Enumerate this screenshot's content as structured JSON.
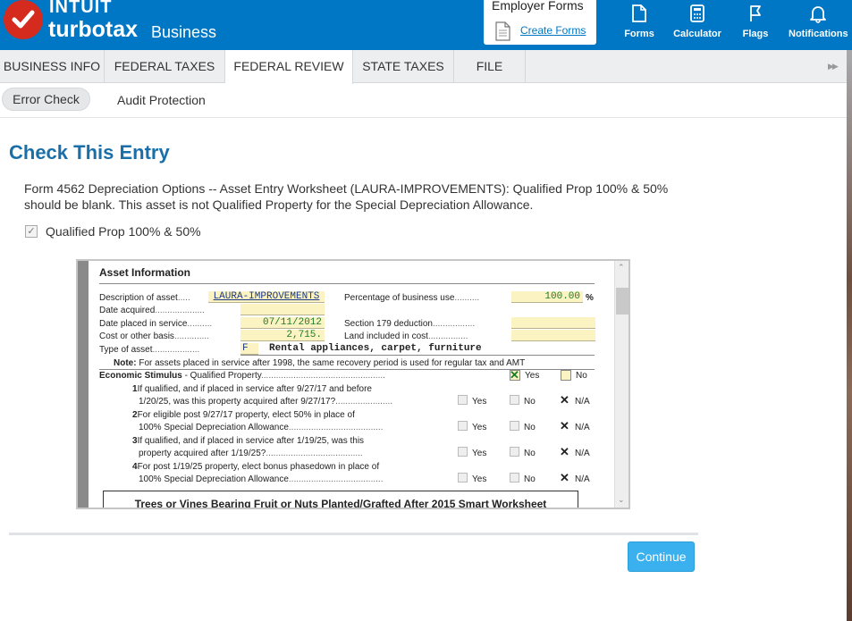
{
  "header": {
    "brand_top": "INTUIT",
    "brand_main": "turbotax",
    "brand_sub": "Business",
    "employer_title": "Employer Forms",
    "employer_link": "Create Forms",
    "buttons": [
      {
        "label": "Forms",
        "icon": "document-icon"
      },
      {
        "label": "Calculator",
        "icon": "calculator-icon"
      },
      {
        "label": "Flags",
        "icon": "flag-icon"
      },
      {
        "label": "Notifications",
        "icon": "bell-icon"
      }
    ]
  },
  "tabs": [
    "BUSINESS INFO",
    "FEDERAL TAXES",
    "FEDERAL REVIEW",
    "STATE TAXES",
    "FILE"
  ],
  "active_tab": "FEDERAL REVIEW",
  "subtabs": {
    "error_check": "Error Check",
    "audit_protection": "Audit Protection"
  },
  "page": {
    "title": "Check This Entry",
    "message": "Form 4562 Depreciation Options -- Asset Entry Worksheet (LAURA-IMPROVEMENTS): Qualified Prop 100% & 50% should be blank. This asset is not Qualified Property for the Special Depreciation Allowance.",
    "checkbox_label": "Qualified Prop 100% & 50%",
    "checkbox_checked": true
  },
  "worksheet": {
    "section_title": "Asset Information",
    "desc_label": "Description of asset",
    "desc_value": "LAURA-IMPROVEMENTS",
    "pct_label": "Percentage of business use",
    "pct_value": "100.00",
    "pct_unit": "%",
    "date_acq_label": "Date acquired",
    "date_placed_label": "Date placed in service",
    "date_placed_value": "07/11/2012",
    "sec179_label": "Section 179 deduction",
    "cost_label": "Cost or other basis",
    "cost_value": "2,715.",
    "land_label": "Land included in cost",
    "type_label": "Type of asset",
    "type_code": "F",
    "type_desc": "Rental appliances, carpet, furniture",
    "note_bold": "Note:",
    "note_text": "For assets placed in service after 1998, the same recovery period is used for regular tax and AMT",
    "econ_bold": "Economic Stimulus",
    "econ_text": "- Qualified Property",
    "econ_yes": "Yes",
    "econ_no": "No",
    "questions": [
      {
        "num": "1",
        "line1": "If qualified, and if placed in service after 9/27/17 and before",
        "line2": "1/20/25, was this property acquired after 9/27/17?"
      },
      {
        "num": "2",
        "line1": "For eligible post 9/27/17 property, elect 50% in place of",
        "line2": "100% Special Depreciation Allowance"
      },
      {
        "num": "3",
        "line1": "If qualified, and if placed in service after 1/19/25, was this",
        "line2": "property acquired after 1/19/25?"
      },
      {
        "num": "4",
        "line1": "For post 1/19/25 property, elect bonus phasedown in place of",
        "line2": "100% Special Depreciation Allowance"
      }
    ],
    "opt_yes": "Yes",
    "opt_no": "No",
    "opt_na": "N/A",
    "trees_title": "Trees or Vines Bearing Fruit or Nuts Planted/Grafted After 2015 Smart Worksheet"
  },
  "continue_label": "Continue",
  "colors": {
    "header_blue": "#0077c5",
    "title_blue": "#1a6fa8",
    "continue_blue": "#3ab0ee",
    "field_yellow": "#fbf4c2"
  }
}
